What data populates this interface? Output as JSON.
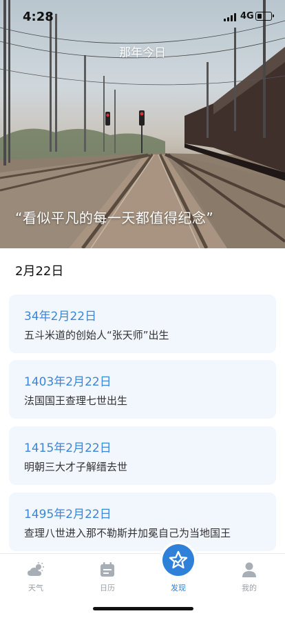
{
  "status_bar": {
    "time": "4:28",
    "network": "4G"
  },
  "header": {
    "title": "那年今日"
  },
  "hero": {
    "quote": "“看似平凡的每一天都值得纪念”"
  },
  "date_heading": "2月22日",
  "events": [
    {
      "date": "34年2月22日",
      "text": "五斗米道的创始人“张天师”出生"
    },
    {
      "date": "1403年2月22日",
      "text": "法国国王查理七世出生"
    },
    {
      "date": "1415年2月22日",
      "text": "明朝三大才子解缙去世"
    },
    {
      "date": "1495年2月22日",
      "text": "查理八世进入那不勒斯并加冕自己为当地国王"
    }
  ],
  "tabs": [
    {
      "label": "天气",
      "icon": "weather-icon",
      "active": false
    },
    {
      "label": "日历",
      "icon": "calendar-icon",
      "active": false
    },
    {
      "label": "发现",
      "icon": "discover-star-icon",
      "active": true
    },
    {
      "label": "我的",
      "icon": "profile-icon",
      "active": false
    }
  ],
  "colors": {
    "accent": "#2f80d8",
    "card_date": "#3a86d8",
    "card_bg": "#f2f6fd",
    "inactive_tab": "#9aa0a8"
  }
}
